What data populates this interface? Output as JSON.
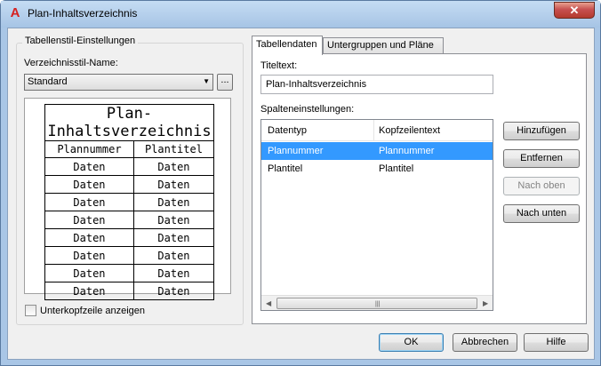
{
  "window": {
    "title": "Plan-Inhaltsverzeichnis",
    "close_glyph": "✕"
  },
  "left": {
    "group_title": "Tabellenstil-Einstellungen",
    "style_name_label": "Verzeichnisstil-Name:",
    "style_value": "Standard",
    "browse_label": "...",
    "preview": {
      "title": "Plan-Inhaltsverzeichnis",
      "headers": [
        "Plannummer",
        "Plantitel"
      ],
      "rows": [
        [
          "Daten",
          "Daten"
        ],
        [
          "Daten",
          "Daten"
        ],
        [
          "Daten",
          "Daten"
        ],
        [
          "Daten",
          "Daten"
        ],
        [
          "Daten",
          "Daten"
        ],
        [
          "Daten",
          "Daten"
        ],
        [
          "Daten",
          "Daten"
        ],
        [
          "Daten",
          "Daten"
        ]
      ]
    },
    "checkbox_label": "Unterkopfzeile anzeigen",
    "checkbox_checked": false
  },
  "tabs": [
    {
      "label": "Tabellendaten",
      "active": true
    },
    {
      "label": "Untergruppen und Pläne",
      "active": false
    }
  ],
  "tab_data": {
    "title_label": "Titeltext:",
    "title_value": "Plan-Inhaltsverzeichnis",
    "columns_label": "Spalteneinstellungen:",
    "columns_header": [
      "Datentyp",
      "Kopfzeilentext"
    ],
    "rows": [
      {
        "type": "Plannummer",
        "header": "Plannummer",
        "selected": true
      },
      {
        "type": "Plantitel",
        "header": "Plantitel",
        "selected": false
      }
    ]
  },
  "side_buttons": {
    "add": "Hinzufügen",
    "remove": "Entfernen",
    "up": "Nach oben",
    "down": "Nach unten"
  },
  "footer": {
    "ok": "OK",
    "cancel": "Abbrechen",
    "help": "Hilfe"
  },
  "colors": {
    "selection": "#3399ff",
    "title_bar": "#a9c6e6",
    "close": "#c75050"
  }
}
